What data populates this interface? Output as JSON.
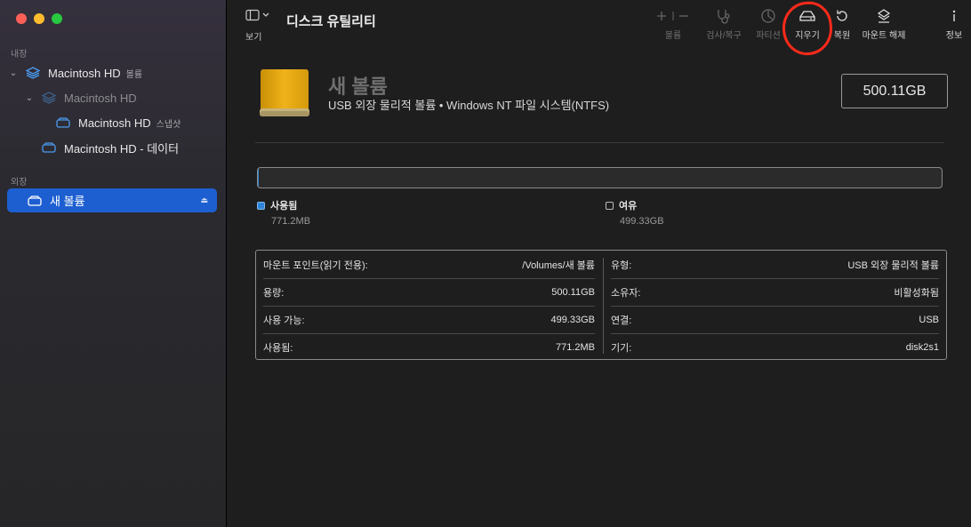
{
  "sidebar": {
    "internal_label": "내장",
    "external_label": "외장",
    "items": [
      {
        "label": "Macintosh HD",
        "sub": "볼륨"
      },
      {
        "label": "Macintosh HD"
      },
      {
        "label": "Macintosh HD",
        "sub": "스냅샷"
      },
      {
        "label": "Macintosh HD - 데이터"
      },
      {
        "label": "새 볼륨"
      }
    ]
  },
  "toolbar": {
    "view_label": "보기",
    "title": "디스크 유틸리티",
    "volume_label": "볼륨",
    "first_aid_label": "검사/복구",
    "partition_label": "파티션",
    "erase_label": "지우기",
    "restore_label": "복원",
    "unmount_label": "마운트 해제",
    "info_label": "정보"
  },
  "volume": {
    "name": "새 볼륨",
    "description": "USB 외장 물리적 볼륨 • Windows NT 파일 시스템(NTFS)",
    "capacity": "500.11GB",
    "used_fraction": 0.0015
  },
  "usage": {
    "used_label": "사용됨",
    "used_value": "771.2MB",
    "free_label": "여유",
    "free_value": "499.33GB"
  },
  "info": {
    "left": [
      {
        "key": "마운트 포인트(읽기 전용):",
        "value": "/Volumes/새 볼륨"
      },
      {
        "key": "용량:",
        "value": "500.11GB"
      },
      {
        "key": "사용 가능:",
        "value": "499.33GB"
      },
      {
        "key": "사용됨:",
        "value": "771.2MB"
      }
    ],
    "right": [
      {
        "key": "유형:",
        "value": "USB 외장 물리적 볼륨"
      },
      {
        "key": "소유자:",
        "value": "비활성화됨"
      },
      {
        "key": "연결:",
        "value": "USB"
      },
      {
        "key": "기기:",
        "value": "disk2s1"
      }
    ]
  },
  "colors": {
    "accent": "#1d5fd1",
    "used": "#2f86d9",
    "annotation": "#ff2a1a"
  }
}
